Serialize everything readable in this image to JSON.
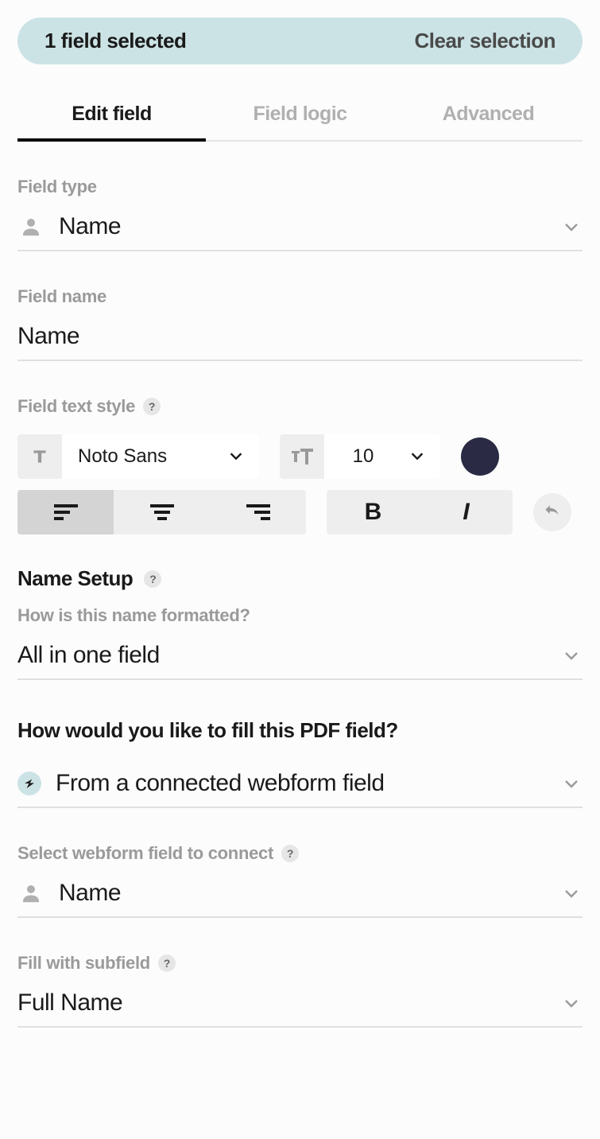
{
  "selectionBanner": {
    "count": "1 field selected",
    "clear": "Clear selection"
  },
  "tabs": {
    "edit": "Edit field",
    "logic": "Field logic",
    "advanced": "Advanced"
  },
  "fieldType": {
    "label": "Field type",
    "value": "Name"
  },
  "fieldName": {
    "label": "Field name",
    "value": "Name"
  },
  "textStyle": {
    "label": "Field text style",
    "font": "Noto Sans",
    "size": "10",
    "color": "#2a2a44"
  },
  "nameSetup": {
    "heading": "Name Setup",
    "formatLabel": "How is this name formatted?",
    "formatValue": "All in one field"
  },
  "fill": {
    "heading": "How would you like to fill this PDF field?",
    "sourceValue": "From a connected webform field"
  },
  "webformField": {
    "label": "Select webform field to connect",
    "value": "Name"
  },
  "subfield": {
    "label": "Fill with subfield",
    "value": "Full Name"
  }
}
